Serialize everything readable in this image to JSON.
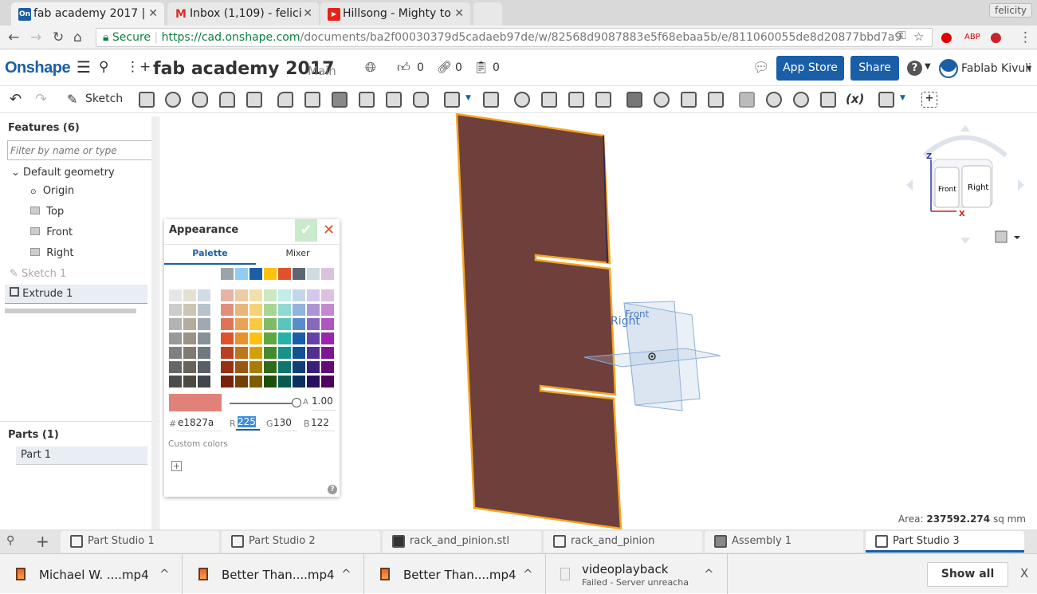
{
  "browser": {
    "tabs": [
      {
        "title": "fab academy 2017 |",
        "favicon": "On",
        "color": "#1a5ea8"
      },
      {
        "title": "Inbox (1,109) - felici",
        "favicon": "M",
        "color": "#d93025"
      },
      {
        "title": "Hillsong - Mighty to",
        "favicon": "▶",
        "color": "#e62117"
      }
    ],
    "profile": "felicity",
    "secure_label": "Secure",
    "url_host": "https://cad.onshape.com",
    "url_path": "/documents/ba2f00030379d5cadaeb97de/w/82568d9087883e5f68ebaa5b/e/811060055de8d20877bbd7a9"
  },
  "header": {
    "logo": "Onshape",
    "title": "fab academy 2017",
    "branch": "Main",
    "likes": "0",
    "links": "0",
    "copies": "0",
    "app_store": "App Store",
    "share": "Share",
    "user": "Fablab Kivuli",
    "help": "?"
  },
  "toolbar": {
    "sketch": "Sketch",
    "variable": "(x)"
  },
  "features": {
    "title": "Features (6)",
    "filter_placeholder": "Filter by name or type",
    "default_geometry": "Default geometry",
    "items": [
      "Origin",
      "Top",
      "Front",
      "Right"
    ],
    "sketch": "Sketch 1",
    "extrude": "Extrude 1",
    "parts_title": "Parts (1)",
    "part": "Part 1"
  },
  "appearance": {
    "title": "Appearance",
    "tab_palette": "Palette",
    "tab_mixer": "Mixer",
    "top_colors": [
      "#9aa4ad",
      "#90cdf0",
      "#1a5ea8",
      "#ffc10e",
      "#e0522b",
      "#5b6670",
      "#cfdbe3",
      "#dac2df"
    ],
    "gray_columns": [
      [
        "#e6e6e6",
        "#cccccc",
        "#b3b3b3",
        "#999999",
        "#808080",
        "#666666",
        "#4d4d4d"
      ],
      [
        "#e6e0d0",
        "#ccc5b5",
        "#b3ac9f",
        "#9a9385",
        "#807b6e",
        "#66635a",
        "#4d4a44"
      ],
      [
        "#d0dce6",
        "#b8c3cc",
        "#a0a9b1",
        "#88919a",
        "#707880",
        "#585f66",
        "#40464b"
      ]
    ],
    "color_columns": [
      [
        "#e6b3a5",
        "#e0907a",
        "#e07356",
        "#e0522b",
        "#b83f1f",
        "#982f14",
        "#78200c"
      ],
      [
        "#edcca5",
        "#e8b67a",
        "#e8a356",
        "#e8922b",
        "#c0741c",
        "#985812",
        "#754008"
      ],
      [
        "#f2e0aa",
        "#f5d278",
        "#f9c942",
        "#ffc10e",
        "#d4a00a",
        "#a87d05",
        "#7d5d02"
      ],
      [
        "#cde8c2",
        "#a8d495",
        "#82bb68",
        "#5da83f",
        "#478a2c",
        "#306b18",
        "#1c5008"
      ],
      [
        "#c2ede8",
        "#8fd9d2",
        "#5cc5bb",
        "#24b3a6",
        "#17928a",
        "#0d756b",
        "#065a50"
      ],
      [
        "#c5d6ec",
        "#93b2dc",
        "#5b8cc7",
        "#1a5ea8",
        "#175090",
        "#123f78",
        "#0c2f62"
      ],
      [
        "#d4c8ec",
        "#ad95d4",
        "#8868bb",
        "#6642a8",
        "#52308f",
        "#3c1d78",
        "#270f5e"
      ],
      [
        "#dcc2e0",
        "#c38ad0",
        "#ad58c0",
        "#9a26b0",
        "#7e1692",
        "#620c76",
        "#4a065a"
      ]
    ],
    "current_color": "#e1827a",
    "alpha_label": "A",
    "alpha": "1.00",
    "alpha_fraction": 1.0,
    "hex_label": "#",
    "hex": "e1827a",
    "r_label": "R",
    "r": "225",
    "g_label": "G",
    "g": "130",
    "b_label": "B",
    "b": "122",
    "custom_colors": "Custom colors"
  },
  "viewport": {
    "area_label": "Area:",
    "area_value": "237592.274",
    "area_unit": "sq mm",
    "plane_labels": [
      "Right",
      "Front"
    ],
    "cube": {
      "front": "Front",
      "right": "Right",
      "z": "Z",
      "x": "X"
    }
  },
  "doc_tabs": [
    {
      "label": "Part Studio 1"
    },
    {
      "label": "Part Studio 2"
    },
    {
      "label": "rack_and_pinion.stl"
    },
    {
      "label": "rack_and_pinion"
    },
    {
      "label": "Assembly 1"
    },
    {
      "label": "Part Studio 3",
      "active": true
    }
  ],
  "downloads": {
    "items": [
      {
        "name": "Michael W. ....mp4"
      },
      {
        "name": "Better Than....mp4"
      },
      {
        "name": "Better Than....mp4"
      },
      {
        "name": "videoplayback",
        "status": "Failed - Server unreacha"
      }
    ],
    "show_all": "Show all",
    "close": "X"
  }
}
